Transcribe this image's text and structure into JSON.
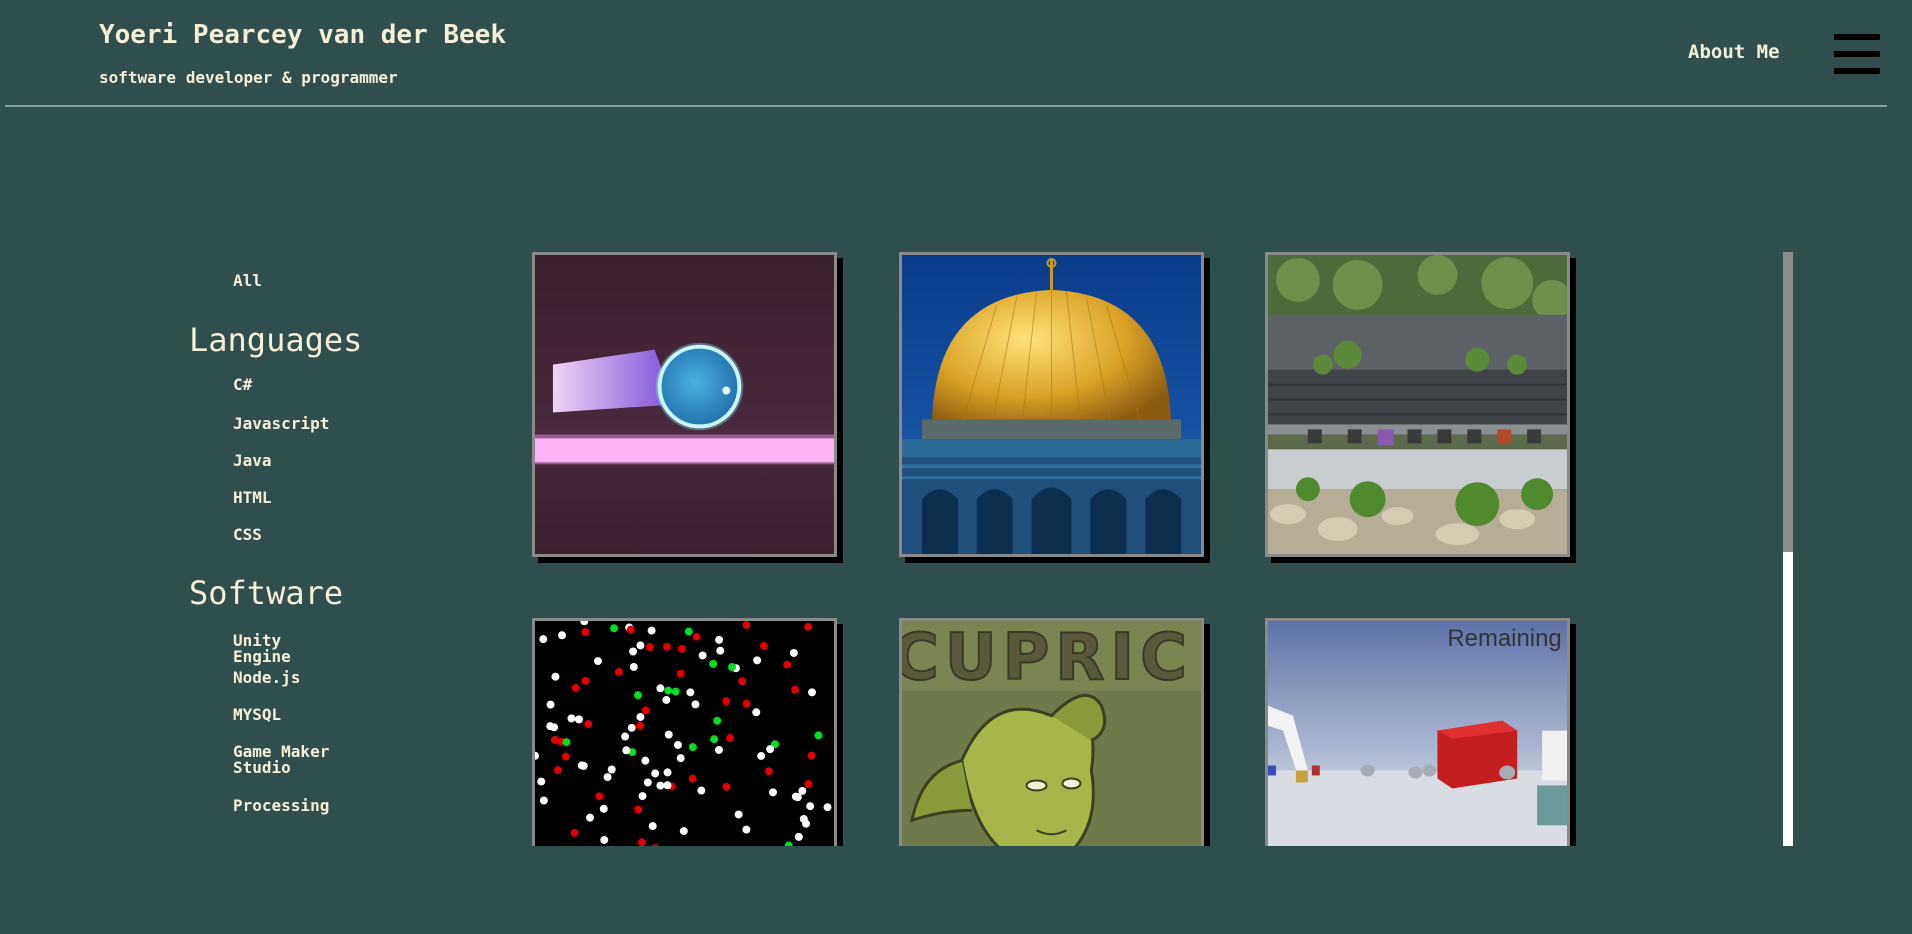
{
  "header": {
    "title": "Yoeri Pearcey van der Beek",
    "subtitle": "software developer & programmer",
    "about_label": "About Me"
  },
  "sidebar": {
    "all_label": "All",
    "languages_heading": "Languages",
    "languages": [
      "C#",
      "Javascript",
      "Java",
      "HTML",
      "CSS"
    ],
    "software_heading": "Software",
    "software": [
      "Unity Engine",
      "Node.js",
      "MYSQL",
      "Game Maker Studio",
      "Processing"
    ]
  },
  "gallery": {
    "tiles": [
      {
        "name": "tile-glowing-ball-game"
      },
      {
        "name": "tile-golden-dome"
      },
      {
        "name": "tile-garden-terrace"
      },
      {
        "name": "tile-particle-simulation"
      },
      {
        "name": "tile-cupric-game"
      },
      {
        "name": "tile-unity-3d-game",
        "overlay_text": "Remaining"
      }
    ],
    "cupric_text": "CUPRIC"
  },
  "colors": {
    "background": "#2f4f4f",
    "text": "#f5efd8",
    "tile_border": "#8a8a8a"
  }
}
